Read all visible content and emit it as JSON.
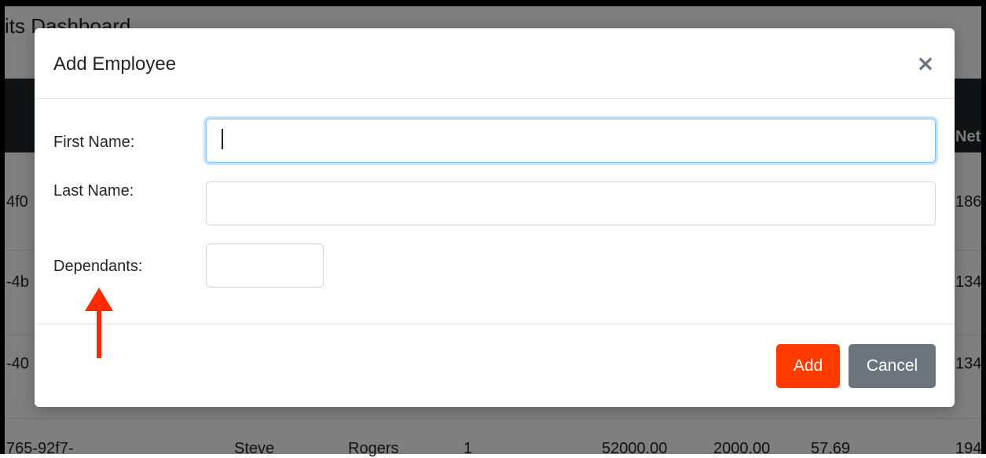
{
  "background": {
    "page_title": "its Dashboard",
    "header_partial": "Net",
    "rows": [
      {
        "id_partial": "4f0",
        "net_partial": "186"
      },
      {
        "id_partial": "-4b",
        "net_partial": "134"
      },
      {
        "id_partial": "-40",
        "net_partial": "134"
      },
      {
        "id_partial": "765-92f7-",
        "first_name": "Steve",
        "last_name": "Rogers",
        "dependants": "1",
        "salary": "52000.00",
        "benefits": "2000.00",
        "per_check": "57.69",
        "net_partial": "194"
      }
    ]
  },
  "modal": {
    "title": "Add Employee",
    "close_glyph": "×",
    "fields": {
      "first_name": {
        "label": "First Name:",
        "value": ""
      },
      "last_name": {
        "label": "Last Name:",
        "value": ""
      },
      "dependants": {
        "label": "Dependants:",
        "value": ""
      }
    },
    "buttons": {
      "add": "Add",
      "cancel": "Cancel"
    }
  },
  "colors": {
    "add_button": "#ff3b00",
    "cancel_button": "#6c757d",
    "annotation_arrow": "#ff2a00",
    "focus_ring": "#80bdff"
  },
  "annotation": {
    "icon": "arrow-up-icon"
  }
}
